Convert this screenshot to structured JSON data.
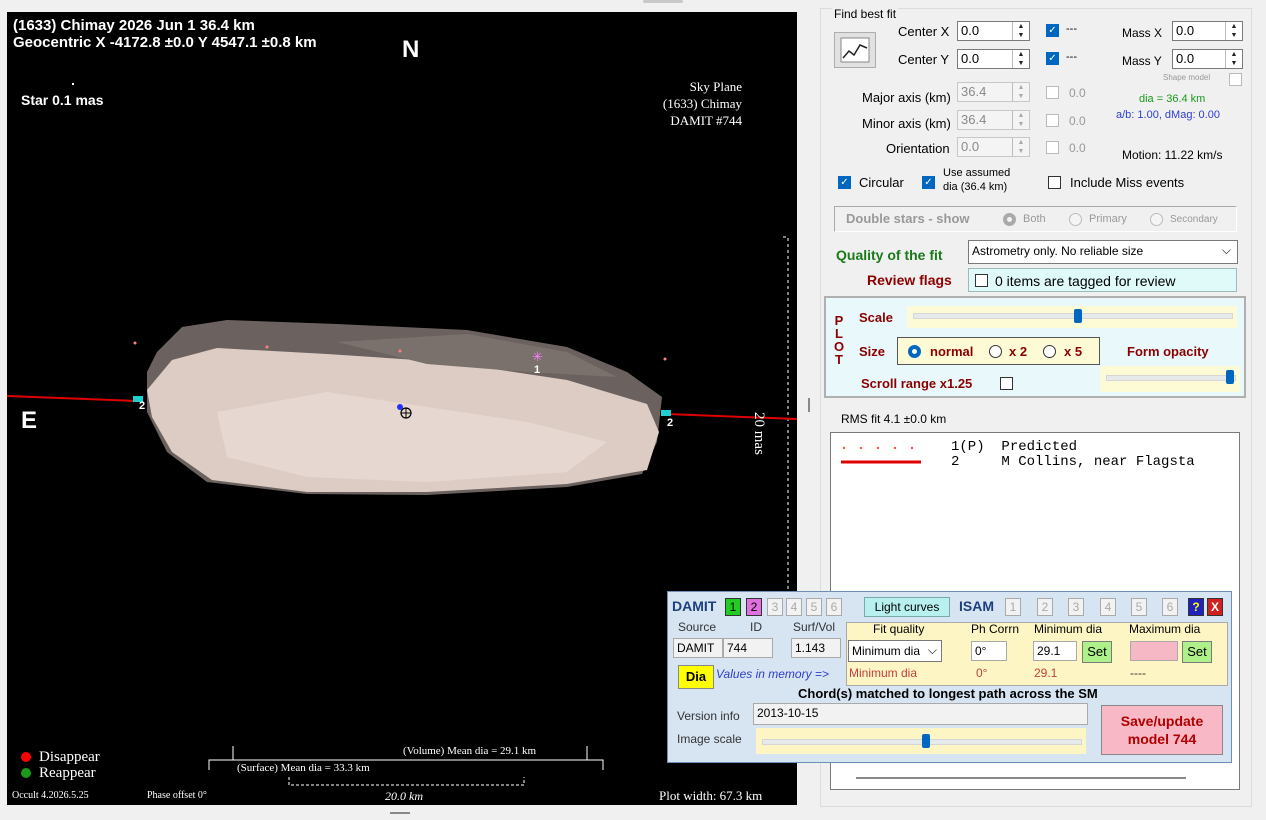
{
  "plot": {
    "title_line1": "(1633) Chimay  2026 Jun 1   36.4 km",
    "title_line2": "Geocentric X -4172.8 ±0.0  Y 4547.1 ±0.8 km",
    "north": "N",
    "east": "E",
    "star": "Star 0.1 mas",
    "sky_plane": "Sky Plane",
    "sky_object": "(1633) Chimay",
    "sky_damit": "DAMIT #744",
    "scale_label": "20 mas",
    "chord_label_1": "1",
    "chord_label_2": "2",
    "legend_disappear": "Disappear",
    "legend_reappear": "Reappear",
    "volume_dia": "(Volume) Mean dia = 29.1 km",
    "surface_dia": "(Surface) Mean dia = 33.3 km",
    "km_scale": "20.0 km",
    "version": "Occult 4.2026.5.25",
    "phase": "Phase offset 0°",
    "plot_width": "Plot width: 67.3 km",
    "colors": {
      "disappear": "#ff0000",
      "reappear": "#1a9a1a",
      "chord": "#e00000"
    }
  },
  "fit": {
    "group_title": "Find best fit",
    "fit_button_icon": "chart-icon",
    "center_x_label": "Center X",
    "center_x": "0.0",
    "center_y_label": "Center Y",
    "center_y": "0.0",
    "center_x_chk": "---",
    "center_y_chk": "---",
    "mass_x_label": "Mass X",
    "mass_x": "0.0",
    "mass_y_label": "Mass Y",
    "mass_y": "0.0",
    "shape_model": "Shape model",
    "major_label": "Major axis (km)",
    "major": "36.4",
    "major_chk": "0.0",
    "minor_label": "Minor axis (km)",
    "minor": "36.4",
    "minor_chk": "0.0",
    "orient_label": "Orientation",
    "orient": "0.0",
    "orient_chk": "0.0",
    "dia_info": "dia = 36.4 km",
    "ab_info": "a/b: 1.00, dMag: 0.00",
    "motion": "Motion: 11.22 km/s",
    "circular": "Circular",
    "use_assumed_1": "Use assumed",
    "use_assumed_2": "dia (36.4 km)",
    "include_miss": "Include Miss events",
    "double_stars": "Double stars - show",
    "both": "Both",
    "primary": "Primary",
    "secondary": "Secondary",
    "quality_label": "Quality of the fit",
    "quality_value": "Astrometry only. No reliable size",
    "review_label": "Review flags",
    "review_value": "0 items are tagged for review"
  },
  "plotbox": {
    "side": "PLOT",
    "scale": "Scale",
    "size": "Size",
    "normal": "normal",
    "x2": "x 2",
    "x5": "x 5",
    "form_opacity": "Form opacity",
    "scroll": "Scroll range x1.25"
  },
  "rms": "RMS fit 4.1 ±0.0 km",
  "chords": [
    {
      "num": "1(P)",
      "name": "Predicted"
    },
    {
      "num": "2",
      "name": "M Collins, near Flagsta"
    }
  ],
  "damit": {
    "damit_label": "DAMIT",
    "nums": [
      "1",
      "2",
      "3",
      "4",
      "5",
      "6"
    ],
    "light_curves": "Light curves",
    "isam_label": "ISAM",
    "help": "?",
    "close": "X",
    "h_source": "Source",
    "h_id": "ID",
    "h_surf": "Surf/Vol",
    "source": "DAMIT",
    "id": "744",
    "surf": "1.143",
    "dia_btn": "Dia",
    "values_memory": "Values in memory =>",
    "h_fitq": "Fit quality",
    "h_phcorr": "Ph Corrn",
    "h_mindia": "Minimum dia",
    "h_maxdia": "Maximum dia",
    "fitq": "Minimum dia",
    "phcorr": "0°",
    "mindia": "29.1",
    "mem_fitq": "Minimum dia",
    "mem_ph": "0°",
    "mem_min": "29.1",
    "mem_max": "----",
    "set": "Set",
    "chord_matched": "Chord(s) matched to longest path across the SM",
    "version_label": "Version info",
    "version": "2013-10-15",
    "image_scale": "Image scale",
    "save_1": "Save/update",
    "save_2": "model 744"
  }
}
